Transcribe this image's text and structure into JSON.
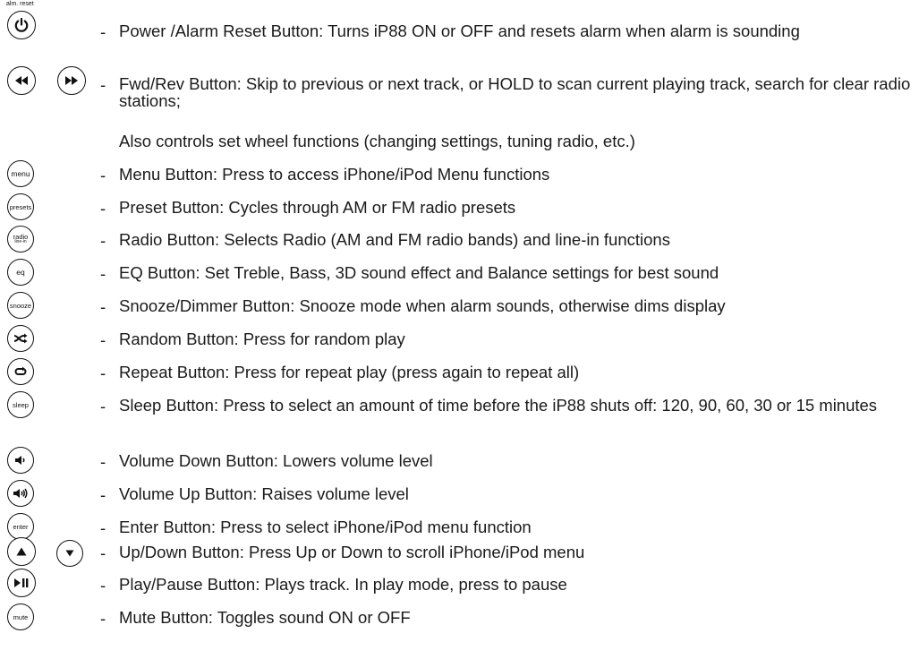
{
  "power_caption": "alm. reset",
  "dash": "-",
  "items": [
    {
      "icon": "power-icon",
      "button_text": "",
      "description": "Power /Alarm Reset Button: Turns iP88 ON or OFF and resets alarm when alarm is sounding"
    },
    {
      "icon": "rewind-icon",
      "icon2": "fast-forward-icon",
      "button_text": "",
      "description": "Fwd/Rev Button: Skip to previous or next track, or HOLD to scan current playing track, search for clear radio stations;"
    },
    {
      "continuation": "Also controls set wheel functions (changing settings, tuning radio, etc.)"
    },
    {
      "icon": "menu",
      "button_text": "menu",
      "description": "Menu Button: Press to access iPhone/iPod Menu functions"
    },
    {
      "icon": "presets",
      "button_text": "presets",
      "description": "Preset Button: Cycles through AM or FM radio presets"
    },
    {
      "icon": "radio-line-in",
      "button_text": "radio",
      "button_subtext": "line-in",
      "description": "Radio Button: Selects Radio (AM and FM radio bands) and line-in functions"
    },
    {
      "icon": "eq",
      "button_text": "eq",
      "description": "EQ Button: Set Treble, Bass, 3D sound effect and Balance settings for best sound"
    },
    {
      "icon": "snooze",
      "button_text": "snooze",
      "description": "Snooze/Dimmer Button: Snooze mode when alarm sounds, otherwise dims display"
    },
    {
      "icon": "shuffle-icon",
      "button_text": "",
      "description": "Random Button: Press for random play"
    },
    {
      "icon": "repeat-icon",
      "button_text": "",
      "description": "Repeat Button: Press for repeat play (press again to repeat all)"
    },
    {
      "icon": "sleep",
      "button_text": "sleep",
      "description": "Sleep Button: Press to select an amount of time before the iP88 shuts off: 120, 90, 60, 30 or 15 minutes"
    },
    {
      "icon": "volume-down-icon",
      "button_text": "",
      "description": "Volume Down Button: Lowers volume level"
    },
    {
      "icon": "volume-up-icon",
      "button_text": "",
      "description": "Volume Up Button: Raises volume level"
    },
    {
      "icon": "enter",
      "button_text": "enter",
      "description": "Enter Button: Press to select iPhone/iPod menu function"
    },
    {
      "icon": "up-arrow-icon",
      "icon2": "down-arrow-icon",
      "button_text": "",
      "description": "Up/Down Button: Press Up or Down to scroll iPhone/iPod menu"
    },
    {
      "icon": "play-pause-icon",
      "button_text": "",
      "description": "Play/Pause Button: Plays track. In play mode, press to pause"
    },
    {
      "icon": "mute",
      "button_text": "mute",
      "description": "Mute Button: Toggles sound ON or OFF"
    }
  ]
}
